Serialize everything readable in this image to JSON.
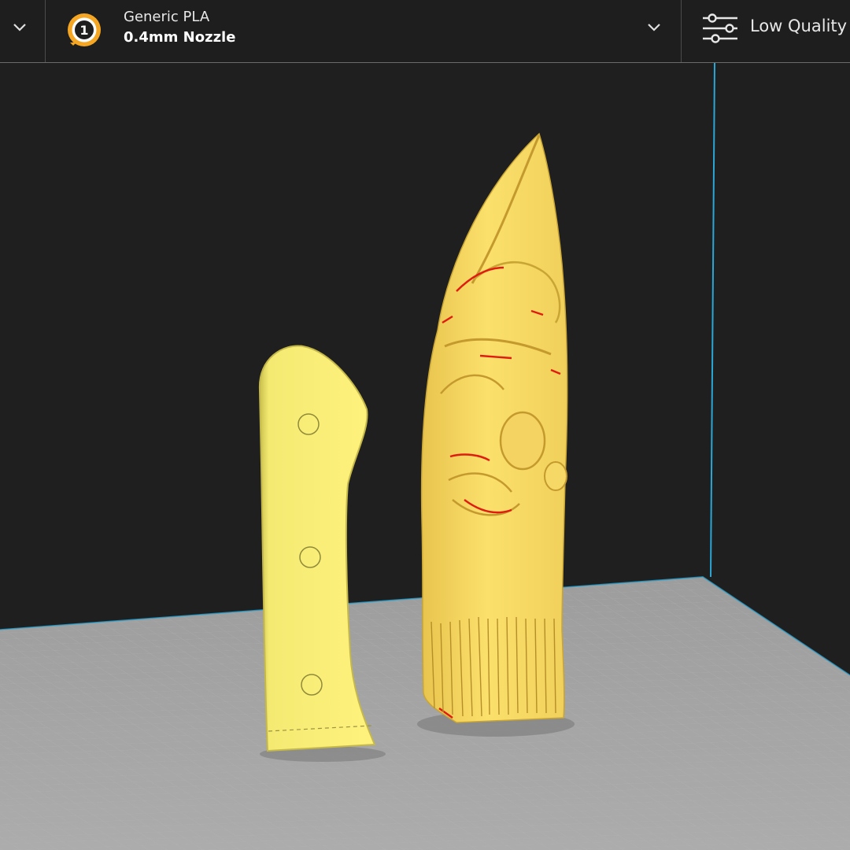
{
  "toolbar": {
    "printer_menu": {
      "icon": "chevron-down-icon"
    },
    "material": {
      "extruder_number": "1",
      "material_name": "Generic PLA",
      "nozzle_label": "0.4mm Nozzle",
      "icon": "extruder-icon",
      "dropdown_icon": "chevron-down-icon"
    },
    "print_settings": {
      "icon": "sliders-icon",
      "label": "Low Quality"
    }
  },
  "viewport": {
    "objects": [
      {
        "name": "knife-handle-model"
      },
      {
        "name": "face-carving-model"
      }
    ],
    "colors": {
      "model": "#f7e26b",
      "overhang": "#e01b12",
      "build_plate": "#a9a9a9",
      "background": "#1f1f20",
      "volume_edge": "#2aa7d6",
      "extruder_accent": "#f5a623"
    }
  }
}
